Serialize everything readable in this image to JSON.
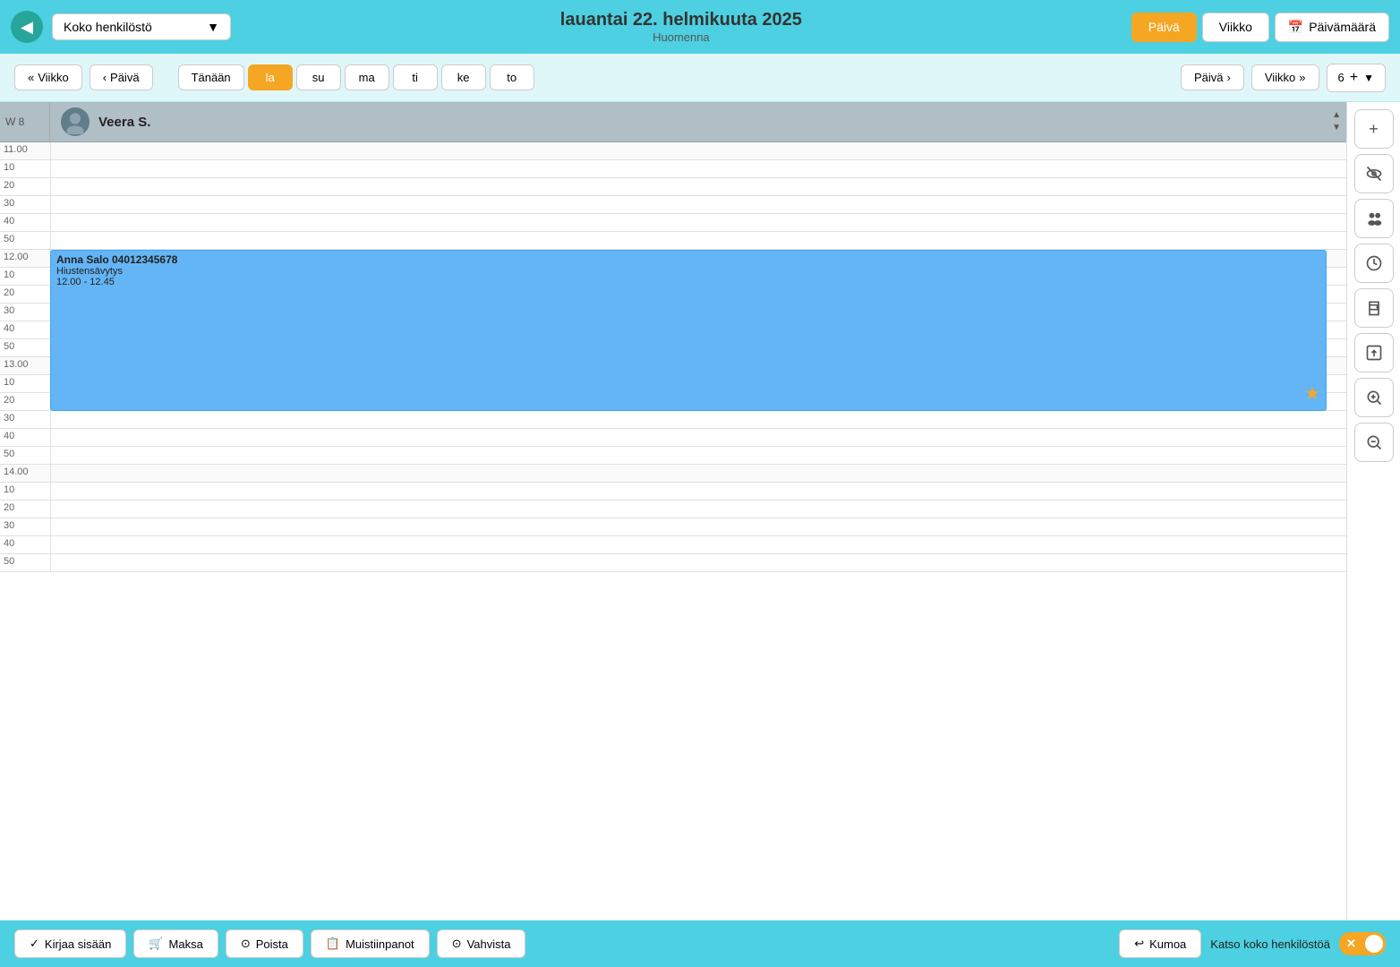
{
  "header": {
    "back_label": "◀",
    "staff_dropdown": "Koko henkilöstö",
    "dropdown_arrow": "▼",
    "title": "lauantai 22. helmikuuta 2025",
    "subtitle": "Huomenna",
    "btn_paiva": "Päivä",
    "btn_viikko": "Viikko",
    "btn_paivamaara": "Päivämäärä",
    "calendar_icon": "📅"
  },
  "nav": {
    "btn_viikko": "Viikko",
    "btn_paiva": "Päivä",
    "days": [
      "Tänään",
      "la",
      "su",
      "ma",
      "ti",
      "ke",
      "to"
    ],
    "active_day": "la",
    "right_paiva": "Päivä",
    "right_viikko": "Viikko",
    "zoom_num": "6",
    "zoom_plus": "+",
    "zoom_arrow": "▼"
  },
  "staff_header": {
    "week": "W 8",
    "name": "Veera S.",
    "scroll_up": "▲",
    "scroll_down": "▼"
  },
  "time_slots": [
    {
      "label": "11.00",
      "is_hour": true
    },
    {
      "label": "10",
      "is_hour": false
    },
    {
      "label": "20",
      "is_hour": false
    },
    {
      "label": "30",
      "is_hour": false
    },
    {
      "label": "40",
      "is_hour": false
    },
    {
      "label": "50",
      "is_hour": false
    },
    {
      "label": "12.00",
      "is_hour": true,
      "has_appointment": true
    },
    {
      "label": "10",
      "is_hour": false
    },
    {
      "label": "20",
      "is_hour": false
    },
    {
      "label": "30",
      "is_hour": false
    },
    {
      "label": "40",
      "is_hour": false
    },
    {
      "label": "50",
      "is_hour": false
    },
    {
      "label": "13.00",
      "is_hour": true
    },
    {
      "label": "10",
      "is_hour": false
    },
    {
      "label": "20",
      "is_hour": false
    },
    {
      "label": "30",
      "is_hour": false
    },
    {
      "label": "40",
      "is_hour": false
    },
    {
      "label": "50",
      "is_hour": false
    },
    {
      "label": "14.00",
      "is_hour": true
    },
    {
      "label": "10",
      "is_hour": false
    },
    {
      "label": "20",
      "is_hour": false
    },
    {
      "label": "30",
      "is_hour": false
    },
    {
      "label": "40",
      "is_hour": false
    },
    {
      "label": "50",
      "is_hour": false
    }
  ],
  "appointment": {
    "client_name": "Anna Salo 04012345678",
    "service": "Hiustensävytys",
    "time": "12.00 - 12.45",
    "star": "★"
  },
  "sidebar_buttons": [
    {
      "name": "add",
      "icon": "+"
    },
    {
      "name": "hide",
      "icon": "👁"
    },
    {
      "name": "group",
      "icon": "👥"
    },
    {
      "name": "clock",
      "icon": "🕐"
    },
    {
      "name": "print",
      "icon": "🖨"
    },
    {
      "name": "export",
      "icon": "📤"
    },
    {
      "name": "zoom-in",
      "icon": "🔍"
    },
    {
      "name": "zoom-out",
      "icon": "🔎"
    }
  ],
  "bottom_bar": {
    "btn_kirjaa": "Kirjaa sisään",
    "btn_maksa": "Maksa",
    "btn_poista": "Poista",
    "btn_muistiinpanot": "Muistiinpanot",
    "btn_vahvista": "Vahvista",
    "btn_kumoa": "Kumoa",
    "toggle_label": "Katso koko henkilöstöä",
    "check_icon": "✓",
    "cart_icon": "🛒",
    "delete_icon": "⊙",
    "notes_icon": "📋",
    "confirm_icon": "⊙",
    "undo_icon": "↩"
  }
}
